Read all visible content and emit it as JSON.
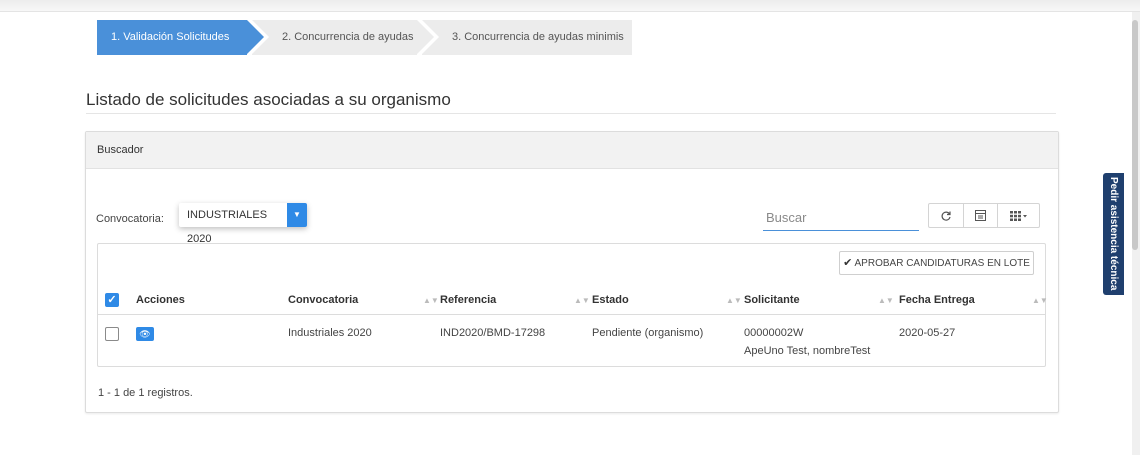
{
  "steps": [
    {
      "label": "1. Validación Solicitudes",
      "active": true
    },
    {
      "label": "2. Concurrencia de ayudas",
      "active": false
    },
    {
      "label": "3. Concurrencia de ayudas minimis",
      "active": false
    }
  ],
  "page_title": "Listado de solicitudes asociadas a su organismo",
  "panel": {
    "header": "Buscador",
    "convocatoria_label": "Convocatoria:",
    "convocatoria_value": "INDUSTRIALES 2020",
    "search_placeholder": "Buscar",
    "toolbar_icons": [
      "refresh-icon",
      "columns-toggle-icon",
      "grid-menu-icon"
    ],
    "bulk_button": "APROBAR CANDIDATURAS EN LOTE"
  },
  "table": {
    "columns": [
      "Acciones",
      "Convocatoria",
      "Referencia",
      "Estado",
      "Solicitante",
      "Fecha Entrega"
    ],
    "rows": [
      {
        "checked": false,
        "convocatoria": "Industriales 2020",
        "referencia": "IND2020/BMD-17298",
        "estado": "Pendiente (organismo)",
        "solicitante_id": "00000002W",
        "solicitante_name": "ApeUno Test, nombreTest",
        "fecha": "2020-05-27"
      }
    ]
  },
  "records_text": "1 - 1 de 1 registros.",
  "side_tab": "Pedir asistencia técnica",
  "colors": {
    "accent": "#2f8ae6",
    "step_active": "#4a90d9",
    "side_tab": "#1f3f6e"
  }
}
